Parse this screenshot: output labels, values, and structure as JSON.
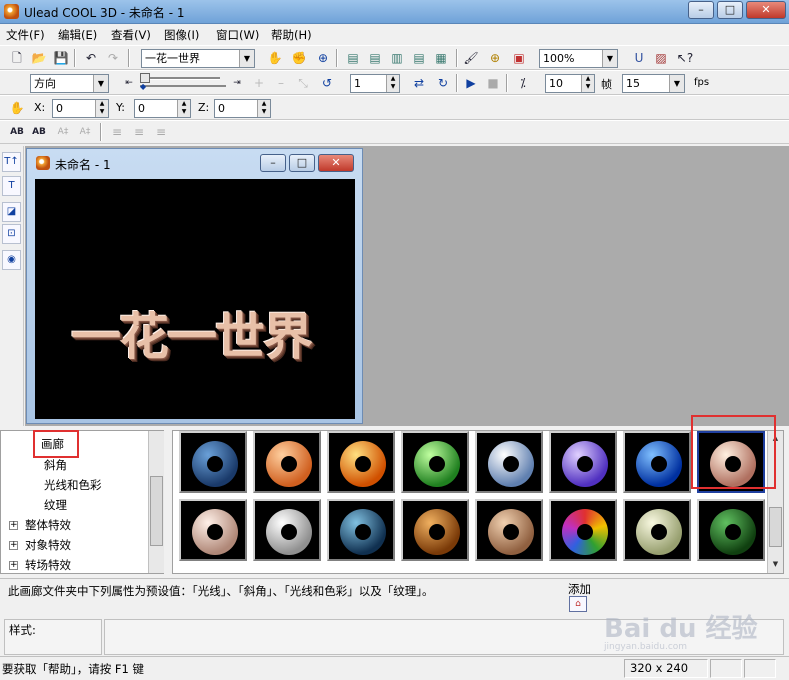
{
  "window": {
    "title": "Ulead COOL 3D - 未命名 - 1",
    "min": "–",
    "max": "□",
    "close": "✕"
  },
  "menu": [
    "文件(F)",
    "编辑(E)",
    "查看(V)",
    "图像(I)",
    "窗口(W)",
    "帮助(H)"
  ],
  "toolbar1": {
    "text_combo": "一花一世界",
    "zoom_combo": "100%"
  },
  "toolbar2": {
    "direction_combo": "方向",
    "frame_value": "1",
    "frames_value": "10",
    "frames_label": "帧",
    "fps_value": "15",
    "fps_label": "fps"
  },
  "toolbar3": {
    "x_label": "X:",
    "x_value": "0",
    "y_label": "Y:",
    "y_value": "0",
    "z_label": "Z:",
    "z_value": "0"
  },
  "document": {
    "title": "未命名 - 1",
    "text3d": "一花一世界"
  },
  "tree": {
    "items": [
      {
        "label": "画廊",
        "indent": 2
      },
      {
        "label": "斜角",
        "indent": 2
      },
      {
        "label": "光线和色彩",
        "indent": 2
      },
      {
        "label": "纹理",
        "indent": 2
      },
      {
        "label": "整体特效",
        "indent": 1,
        "expander": "+"
      },
      {
        "label": "对象特效",
        "indent": 1,
        "expander": "+"
      },
      {
        "label": "转场特效",
        "indent": 1,
        "expander": "+"
      }
    ]
  },
  "gallery": {
    "row1": [
      "blue-stone",
      "orange",
      "orange-gradient",
      "green",
      "silver-marble",
      "violet",
      "blue-water",
      "pink-marble"
    ],
    "row2": [
      "pink-stone",
      "gray-stone",
      "blue-swirl",
      "wood",
      "knit",
      "rainbow",
      "pale-marble",
      "green-wood"
    ]
  },
  "info": {
    "description": "此画廊文件夹中下列属性为预设值：「光线」、「斜角」、「光线和色彩」以及「纹理」。",
    "add_label": "添加",
    "style_label": "样式:"
  },
  "status": {
    "help": "要获取「帮助」，请按 F1 键",
    "size": "320 x 240"
  },
  "watermark": {
    "logo": "Bai du 经验",
    "sub": "jingyan.baidu.com"
  },
  "colors": {
    "highlight": "#e03030",
    "title_gradient_top": "#9cc3ea"
  }
}
